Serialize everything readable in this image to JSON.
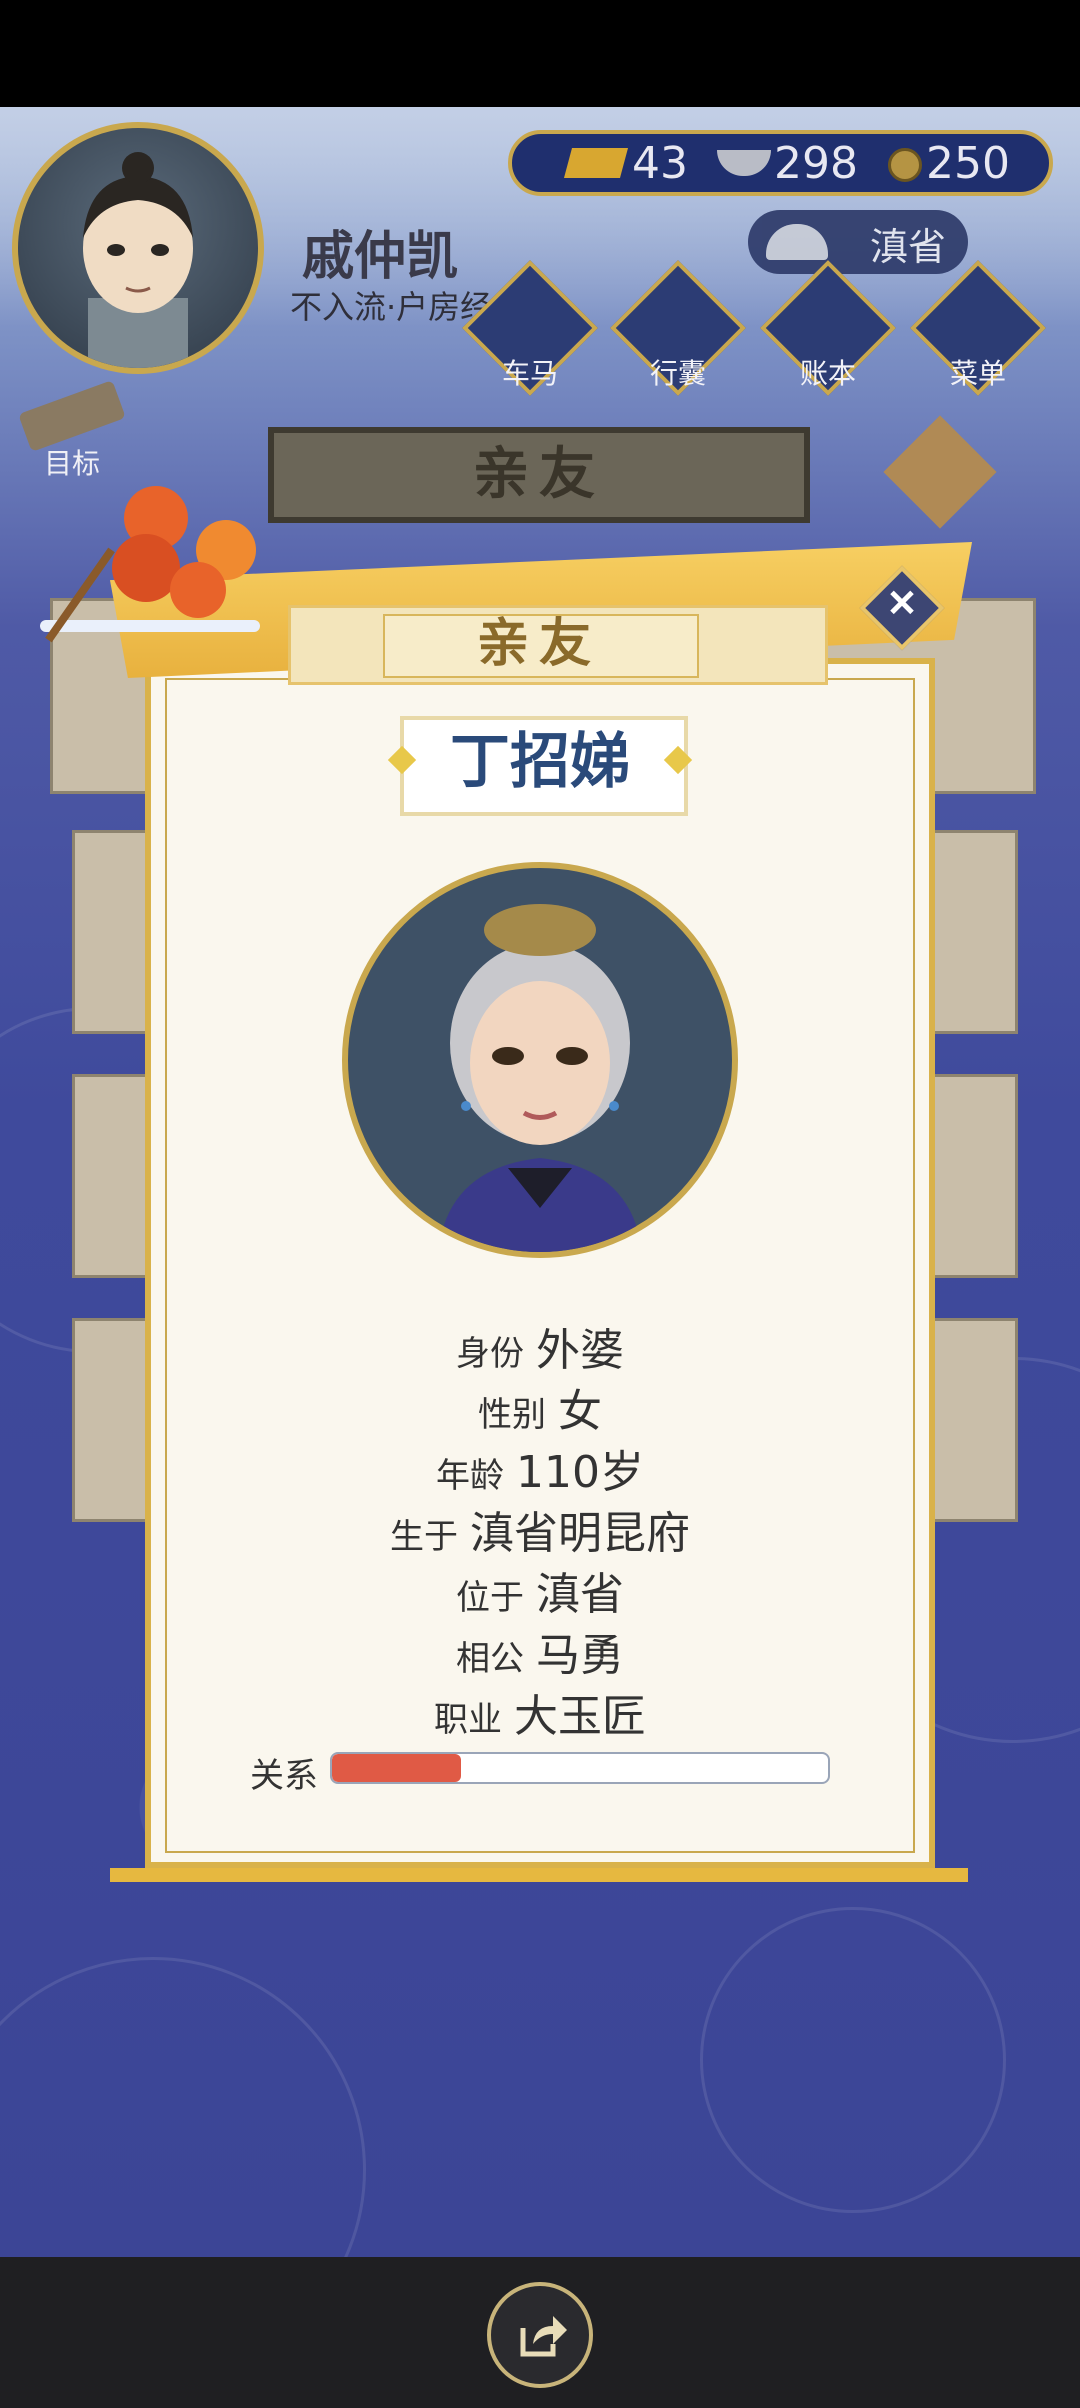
{
  "resources": {
    "gold": "43",
    "silver": "298",
    "coins": "250"
  },
  "player": {
    "name": "戚仲凯",
    "rank": "不入流·户房经"
  },
  "location": "滇省",
  "nav": [
    {
      "label": "车马",
      "icon": "carriage-icon"
    },
    {
      "label": "行囊",
      "icon": "bag-icon"
    },
    {
      "label": "账本",
      "icon": "ledger-icon"
    },
    {
      "label": "菜单",
      "icon": "menu-dots-icon"
    }
  ],
  "goal_label": "目标",
  "background_title": "亲友",
  "modal": {
    "header_title": "亲友",
    "name": "丁招娣",
    "info": [
      {
        "key": "身份",
        "value": "外婆"
      },
      {
        "key": "性别",
        "value": "女"
      },
      {
        "key": "年龄",
        "value": "110岁"
      },
      {
        "key": "生于",
        "value": "滇省明昆府"
      },
      {
        "key": "位于",
        "value": "滇省"
      },
      {
        "key": "相公",
        "value": "马勇"
      },
      {
        "key": "职业",
        "value": "大玉匠"
      }
    ],
    "relation_label": "关系",
    "relation_level": 0.26
  },
  "colors": {
    "gold_trim": "#d9b24a",
    "panel_bg": "#faf7ee",
    "relation_fill": "#e05a45",
    "name_blue": "#2a4a7a"
  }
}
